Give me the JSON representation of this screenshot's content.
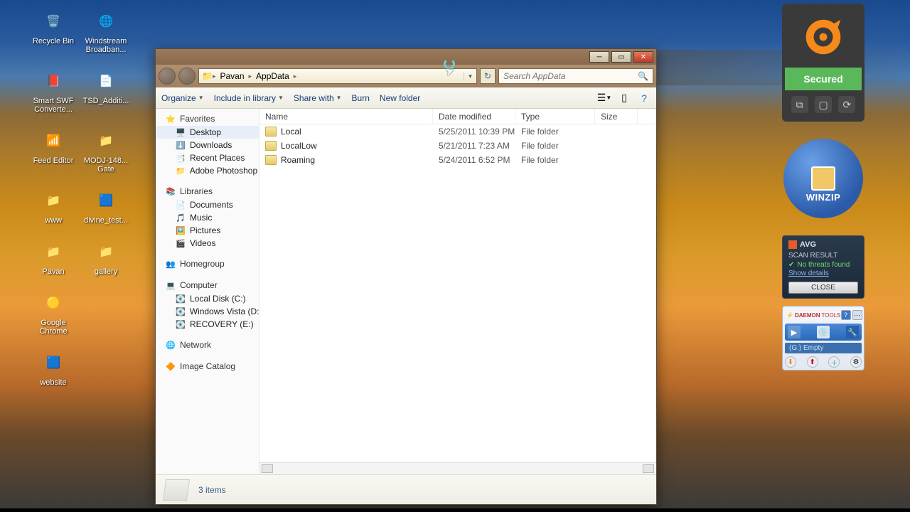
{
  "desktop": {
    "icons": [
      {
        "label": "Recycle Bin"
      },
      {
        "label": "Windstream Broadban..."
      },
      {
        "label": "Smart SWF Converte..."
      },
      {
        "label": "TSD_Additi..."
      },
      {
        "label": "Feed Editor"
      },
      {
        "label": "MODJ-148... Gate"
      },
      {
        "label": "www"
      },
      {
        "label": "divine_test..."
      },
      {
        "label": "Pavan"
      },
      {
        "label": "gallery"
      },
      {
        "label": "Google Chrome"
      },
      {
        "label": ""
      },
      {
        "label": "website"
      },
      {
        "label": ""
      }
    ]
  },
  "explorer": {
    "breadcrumb": [
      "Pavan",
      "AppData"
    ],
    "search_placeholder": "Search AppData",
    "toolbar": {
      "organize": "Organize",
      "include": "Include in library",
      "share": "Share with",
      "burn": "Burn",
      "newfolder": "New folder"
    },
    "nav": {
      "favorites": {
        "label": "Favorites",
        "items": [
          "Desktop",
          "Downloads",
          "Recent Places",
          "Adobe Photoshop C"
        ]
      },
      "libraries": {
        "label": "Libraries",
        "items": [
          "Documents",
          "Music",
          "Pictures",
          "Videos"
        ]
      },
      "homegroup": {
        "label": "Homegroup"
      },
      "computer": {
        "label": "Computer",
        "items": [
          "Local Disk (C:)",
          "Windows Vista (D:)",
          "RECOVERY (E:)"
        ]
      },
      "network": {
        "label": "Network"
      },
      "imgcat": {
        "label": "Image Catalog"
      }
    },
    "columns": {
      "name": "Name",
      "date": "Date modified",
      "type": "Type",
      "size": "Size"
    },
    "rows": [
      {
        "name": "Local",
        "date": "5/25/2011 10:39 PM",
        "type": "File folder"
      },
      {
        "name": "LocalLow",
        "date": "5/21/2011 7:23 AM",
        "type": "File folder"
      },
      {
        "name": "Roaming",
        "date": "5/24/2011 6:52 PM",
        "type": "File folder"
      }
    ],
    "status": "3 items"
  },
  "avast": {
    "secured": "Secured"
  },
  "winzip": {
    "label": "WINZIP"
  },
  "avg": {
    "brand": "AVG",
    "scan": "SCAN RESULT",
    "ok": "No threats found",
    "details": "Show details",
    "close": "CLOSE"
  },
  "daemon": {
    "brand": "DAEMON",
    "sub": "TOOLS",
    "drive": "(G:) Empty"
  }
}
